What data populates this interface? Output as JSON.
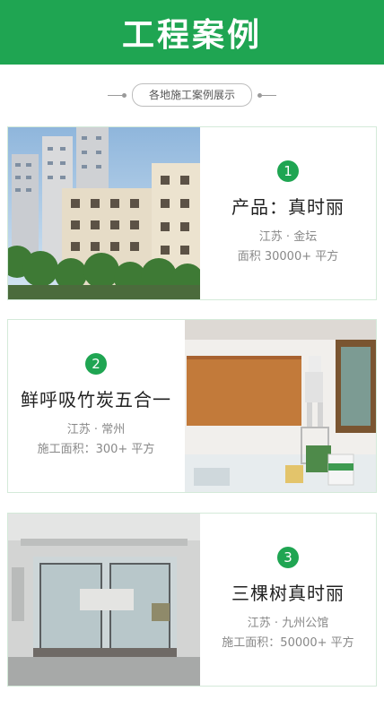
{
  "header": {
    "title": "工程案例"
  },
  "section": {
    "subtitle": "各地施工案例展示"
  },
  "cases": [
    {
      "number": "1",
      "product": "产品：真时丽",
      "location": "江苏 · 金坛",
      "area": "面积 30000+ 平方"
    },
    {
      "number": "2",
      "product": "鲜呼吸竹炭五合一",
      "location": "江苏 · 常州",
      "area": "施工面积：300+ 平方"
    },
    {
      "number": "3",
      "product": "三棵树真时丽",
      "location": "江苏 · 九州公馆",
      "area": "施工面积：50000+ 平方"
    }
  ],
  "colors": {
    "brand_green": "#1fa552"
  }
}
